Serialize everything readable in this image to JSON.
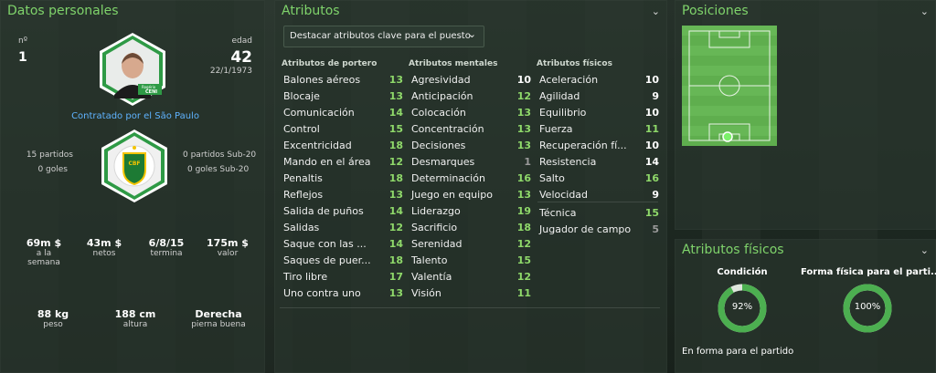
{
  "personal": {
    "title": "Datos personales",
    "number_label": "nº",
    "number": "1",
    "age_label": "edad",
    "age": "42",
    "birthdate": "22/1/1973",
    "club_link": "Contratado por el São Paulo",
    "player_name_small": "Rogério",
    "player_surname_small": "CENI",
    "caps_left": "15 partidos",
    "goals_left": "0 goles",
    "caps_right": "0 partidos Sub-20",
    "goals_right": "0 goles Sub-20",
    "nat_badge_text": "CBF",
    "stats": [
      {
        "value": "69m $",
        "label": "a la semana"
      },
      {
        "value": "43m $",
        "label": "netos"
      },
      {
        "value": "6/8/15",
        "label": "termina"
      },
      {
        "value": "175m $",
        "label": "valor"
      }
    ],
    "physical": [
      {
        "value": "88 kg",
        "label": "peso"
      },
      {
        "value": "188 cm",
        "label": "altura"
      },
      {
        "value": "Derecha",
        "label": "pierna buena"
      }
    ]
  },
  "attributes": {
    "title": "Atributos",
    "highlight_button": "Destacar atributos clave para el puesto",
    "columns": [
      {
        "header": "Atributos de portero",
        "rows": [
          {
            "name": "Balones aéreos",
            "value": "13",
            "color": "green"
          },
          {
            "name": "Blocaje",
            "value": "13",
            "color": "green"
          },
          {
            "name": "Comunicación",
            "value": "14",
            "color": "green"
          },
          {
            "name": "Control",
            "value": "15",
            "color": "green"
          },
          {
            "name": "Excentricidad",
            "value": "18",
            "color": "green"
          },
          {
            "name": "Mando en el área",
            "value": "12",
            "color": "green"
          },
          {
            "name": "Penaltis",
            "value": "18",
            "color": "green"
          },
          {
            "name": "Reflejos",
            "value": "13",
            "color": "green"
          },
          {
            "name": "Salida de puños",
            "value": "14",
            "color": "green"
          },
          {
            "name": "Salidas",
            "value": "12",
            "color": "green"
          },
          {
            "name": "Saque con las ...",
            "value": "14",
            "color": "green"
          },
          {
            "name": "Saques de puer...",
            "value": "18",
            "color": "green"
          },
          {
            "name": "Tiro libre",
            "value": "17",
            "color": "green"
          },
          {
            "name": "Uno contra uno",
            "value": "13",
            "color": "green"
          }
        ]
      },
      {
        "header": "Atributos mentales",
        "rows": [
          {
            "name": "Agresividad",
            "value": "10",
            "color": "white"
          },
          {
            "name": "Anticipación",
            "value": "12",
            "color": "green"
          },
          {
            "name": "Colocación",
            "value": "13",
            "color": "green"
          },
          {
            "name": "Concentración",
            "value": "13",
            "color": "green"
          },
          {
            "name": "Decisiones",
            "value": "13",
            "color": "green"
          },
          {
            "name": "Desmarques",
            "value": "1",
            "color": "grey"
          },
          {
            "name": "Determinación",
            "value": "16",
            "color": "green"
          },
          {
            "name": "Juego en equipo",
            "value": "13",
            "color": "green"
          },
          {
            "name": "Liderazgo",
            "value": "19",
            "color": "green"
          },
          {
            "name": "Sacrificio",
            "value": "18",
            "color": "green"
          },
          {
            "name": "Serenidad",
            "value": "12",
            "color": "green"
          },
          {
            "name": "Talento",
            "value": "15",
            "color": "green"
          },
          {
            "name": "Valentía",
            "value": "12",
            "color": "green"
          },
          {
            "name": "Visión",
            "value": "11",
            "color": "green"
          }
        ]
      },
      {
        "header": "Atributos físicos",
        "rows": [
          {
            "name": "Aceleración",
            "value": "10",
            "color": "white"
          },
          {
            "name": "Agilidad",
            "value": "9",
            "color": "white"
          },
          {
            "name": "Equilibrio",
            "value": "10",
            "color": "white"
          },
          {
            "name": "Fuerza",
            "value": "11",
            "color": "green"
          },
          {
            "name": "Recuperación fí...",
            "value": "10",
            "color": "white"
          },
          {
            "name": "Resistencia",
            "value": "14",
            "color": "white"
          },
          {
            "name": "Salto",
            "value": "16",
            "color": "green"
          },
          {
            "name": "Velocidad",
            "value": "9",
            "color": "white"
          },
          {
            "name": "Técnica",
            "value": "15",
            "color": "green"
          },
          {
            "name": "Jugador de campo",
            "value": "5",
            "color": "grey"
          }
        ]
      }
    ]
  },
  "positions": {
    "title": "Posiciones"
  },
  "fitness": {
    "title": "Atributos físicos",
    "condition_label": "Condición",
    "condition_value": "92%",
    "condition_level": 0.92,
    "match_fitness_label": "Forma física para el parti...",
    "match_fitness_value": "100%",
    "match_fitness_level": 1.0,
    "status": "En forma para el partido"
  },
  "colors": {
    "accent": "#7fd36b",
    "ring_green": "#4caf50",
    "ring_track": "#dfe6dd",
    "pitch": "#5fae4e"
  },
  "icons": {
    "chevron": "chevron-down-icon",
    "player_photo": "player-photo",
    "national_badge": "cbf-badge-icon"
  }
}
